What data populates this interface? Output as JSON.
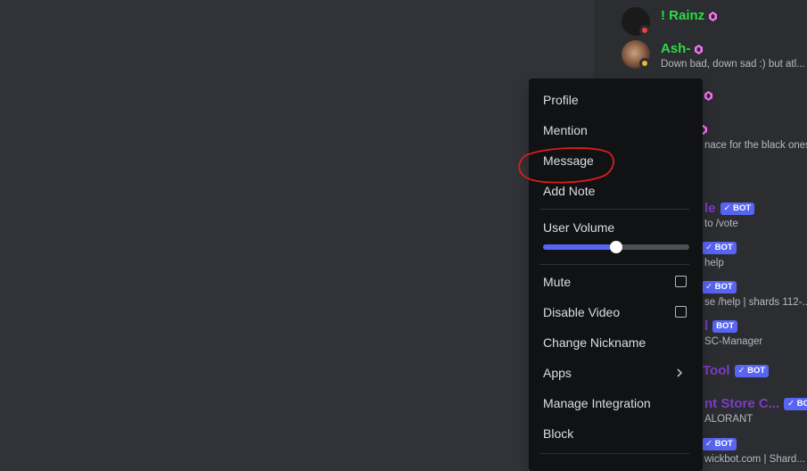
{
  "members": [
    {
      "name": "! Rainz",
      "name_color": "#2cdc42",
      "status_text": "",
      "status": "dnd",
      "has_gem": true,
      "bot": false
    },
    {
      "name": "Ash-",
      "name_color": "#2cdc42",
      "status_text": "Down bad, down sad :) but atl...",
      "status": "idle",
      "has_gem": true,
      "bot": false
    },
    {
      "name": "",
      "name_color": "#2cdc42",
      "status_text": "",
      "status": "",
      "has_gem": true,
      "bot": false
    },
    {
      "name": "",
      "name_color": "#2cdc42",
      "status_text": "nace for the black ones",
      "status": "",
      "has_gem": true,
      "bot": false
    },
    {
      "name": "le",
      "name_color": "#7c3cc8",
      "status_text": "to /vote",
      "status": "",
      "has_gem": false,
      "bot": true
    },
    {
      "name": "",
      "name_color": "#7c3cc8",
      "status_text": "help",
      "status": "",
      "has_gem": false,
      "bot": true
    },
    {
      "name": "",
      "name_color": "#7c3cc8",
      "status_text": "se /help | shards 112-...",
      "status": "",
      "has_gem": false,
      "bot": true
    },
    {
      "name": "l",
      "name_color": "#7c3cc8",
      "status_text": "SC-Manager",
      "status": "",
      "has_gem": false,
      "bot": true
    },
    {
      "name": "Tool",
      "name_color": "#7c3cc8",
      "status_text": "",
      "status": "",
      "has_gem": false,
      "bot": true
    },
    {
      "name": "nt Store C...",
      "name_color": "#7c3cc8",
      "status_text": "ALORANT",
      "status": "",
      "has_gem": false,
      "bot": true
    },
    {
      "name": "",
      "name_color": "#7c3cc8",
      "status_text": "wickbot.com | Shard...",
      "status": "",
      "has_gem": false,
      "bot": true
    }
  ],
  "bot_tag_label": "✓ BOT",
  "context_menu": {
    "profile": "Profile",
    "mention": "Mention",
    "message": "Message",
    "add_note": "Add Note",
    "user_volume": "User Volume",
    "user_volume_level": 0.5,
    "mute": "Mute",
    "disable_video": "Disable Video",
    "change_nickname": "Change Nickname",
    "apps": "Apps",
    "manage_integration": "Manage Integration",
    "block": "Block"
  },
  "colors": {
    "background": "#313338",
    "member_list": "#2b2d31",
    "menu": "#111214",
    "accent": "#5865f2",
    "annotation": "#e01b1b"
  }
}
